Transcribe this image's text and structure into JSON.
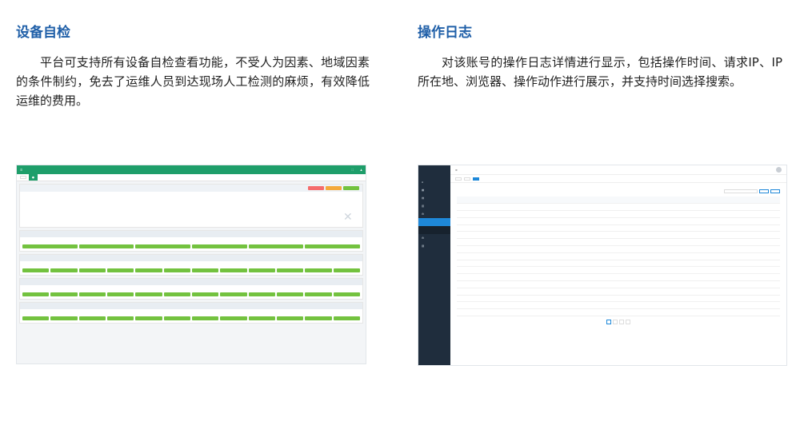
{
  "left": {
    "title": "设备自检",
    "body": "平台可支持所有设备自检查看功能，不受人为因素、地域因素的条件制约，免去了运维人员到达现场人工检测的麻烦，有效降低运维的费用。"
  },
  "right": {
    "title": "操作日志",
    "body": "对该账号的操作日志详情进行显示，包括操作时间、请求IP、IP所在地、浏览器、操作动作进行展示，并支持时间选择搜索。"
  },
  "colors": {
    "title": "#1f5fa8",
    "green_header": "#1e9e6a",
    "green_bar": "#73c23f",
    "blue_accent": "#1e88d9",
    "sidebar_dark": "#1f2d3d"
  }
}
